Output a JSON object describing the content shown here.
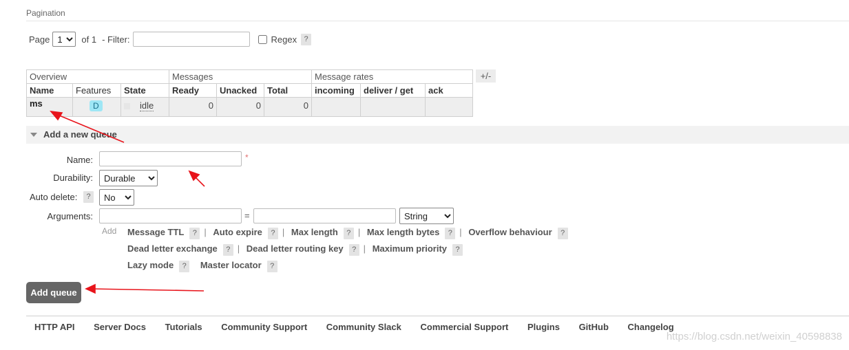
{
  "pagination": {
    "section_title": "Pagination",
    "page_label": "Page",
    "page_value": "1",
    "of_label": "of 1",
    "filter_label": "- Filter:",
    "filter_value": "",
    "regex_label": "Regex",
    "help": "?"
  },
  "table": {
    "groups": [
      "Overview",
      "Messages",
      "Message rates"
    ],
    "columns": [
      "Name",
      "Features",
      "State",
      "Ready",
      "Unacked",
      "Total",
      "incoming",
      "deliver / get",
      "ack"
    ],
    "rows": [
      {
        "name": "ms",
        "feature": "D",
        "state": "idle",
        "ready": "0",
        "unacked": "0",
        "total": "0",
        "incoming": "",
        "deliver_get": "",
        "ack": ""
      }
    ],
    "toggle_columns": "+/-"
  },
  "add_queue": {
    "title": "Add a new queue",
    "name_label": "Name:",
    "name_value": "",
    "required_mark": "*",
    "durability_label": "Durability:",
    "durability_value": "Durable",
    "auto_delete_label": "Auto delete:",
    "auto_delete_value": "No",
    "arguments_label": "Arguments:",
    "argument_key": "",
    "equals": "=",
    "argument_value": "",
    "argument_type": "String",
    "add_label": "Add",
    "argument_keys_row1": [
      "Message TTL",
      "Auto expire",
      "Max length",
      "Max length bytes",
      "Overflow behaviour"
    ],
    "argument_keys_row2": [
      "Dead letter exchange",
      "Dead letter routing key",
      "Maximum priority"
    ],
    "argument_keys_row3": [
      "Lazy mode",
      "Master locator"
    ],
    "separator": "|",
    "submit_label": "Add queue"
  },
  "footer": {
    "links": [
      "HTTP API",
      "Server Docs",
      "Tutorials",
      "Community Support",
      "Community Slack",
      "Commercial Support",
      "Plugins",
      "GitHub",
      "Changelog"
    ]
  },
  "watermark": "https://blog.csdn.net/weixin_40598838",
  "colors": {
    "annotation_arrow": "#e8141b",
    "feature_badge": "#9ee6f5",
    "button": "#666666"
  }
}
